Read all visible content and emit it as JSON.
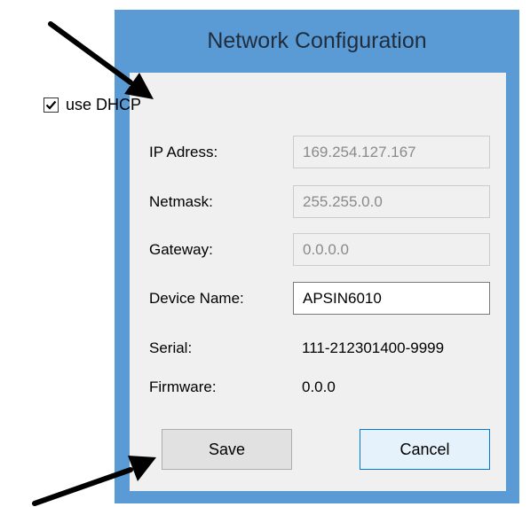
{
  "dialog": {
    "title": "Network Configuration"
  },
  "dhcp": {
    "label": "use DHCP",
    "checked": true
  },
  "fields": {
    "ip": {
      "label": "IP Adress:",
      "value": "169.254.127.167"
    },
    "netmask": {
      "label": "Netmask:",
      "value": "255.255.0.0"
    },
    "gateway": {
      "label": "Gateway:",
      "value": "0.0.0.0"
    },
    "device_name": {
      "label": "Device Name:",
      "value": "APSIN6010"
    },
    "serial": {
      "label": "Serial:",
      "value": "111-212301400-9999"
    },
    "firmware": {
      "label": "Firmware:",
      "value": "0.0.0"
    }
  },
  "buttons": {
    "save": "Save",
    "cancel": "Cancel"
  },
  "colors": {
    "window_frame": "#5b9bd5",
    "client_background": "#f0f0f0",
    "arrow": "#000000"
  }
}
